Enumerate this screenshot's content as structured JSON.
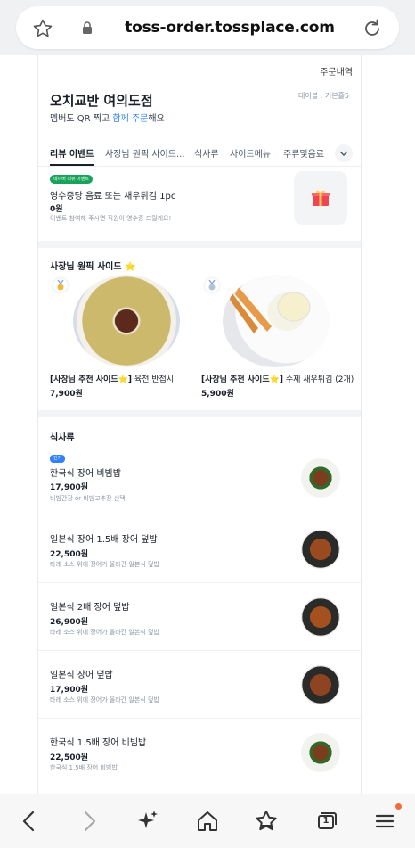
{
  "browser": {
    "url": "toss-order.tossplace.com"
  },
  "header": {
    "order_history": "주문내역",
    "store_name": "오치교반 여의도점",
    "table_label": "테이블 : 기본홀5",
    "sub_prefix": "멤버도 QR 찍고 ",
    "sub_highlight": "함께 주문",
    "sub_suffix": "해요"
  },
  "tabs": [
    {
      "label": "리뷰 이벤트",
      "active": true
    },
    {
      "label": "사장님 원픽 사이드...",
      "active": false
    },
    {
      "label": "식사류",
      "active": false
    },
    {
      "label": "사이드메뉴",
      "active": false
    },
    {
      "label": "주류및음료",
      "active": false
    }
  ],
  "event": {
    "badge": "네이버 리뷰 이벤트",
    "title": "영수증당 음료 또는 새우튀김 1pc",
    "price": "0원",
    "desc": "이벤트 참여해 주시면 직원이 영수증 드릴게요!"
  },
  "picks": {
    "title": "사장님 원픽 사이드 ⭐",
    "items": [
      {
        "prefix": "[사장님 추천 사이드⭐]",
        "name": " 육전 반접시",
        "price": "7,900원",
        "medal": "gold"
      },
      {
        "prefix": "[사장님 추천 사이드⭐]",
        "name": " 수제 새우튀김 (2개)",
        "price": "5,900원",
        "medal": "silver"
      }
    ]
  },
  "meals": {
    "title": "식사류",
    "items": [
      {
        "badge": "인기",
        "name": "한국식 장어 비빔밥",
        "price": "17,900원",
        "desc": "비빔간장 or 비빔고추장 선택"
      },
      {
        "name": "일본식 장어 1.5배 장어 덮밥",
        "price": "22,500원",
        "desc": "타레 소스 위에 장어가 올라간 일본식 덮밥"
      },
      {
        "name": "일본식 2배 장어 덮밥",
        "price": "26,900원",
        "desc": "타레 소스 위에 장어가 올라간 일본식 덮밥"
      },
      {
        "name": "일본식 장어 덮밥",
        "price": "17,900원",
        "desc": "타레 소스 위에 장어가 올라간 일본식 덮밥"
      },
      {
        "name": "한국식 1.5배 장어 비빔밥",
        "price": "22,500원",
        "desc": "한국식 1.5배 장어 비빔밥"
      }
    ]
  },
  "bottom_nav": {
    "icons": [
      "back-icon",
      "forward-icon",
      "sparkle-icon",
      "home-icon",
      "star-favorite-icon",
      "tabs-icon",
      "menu-icon"
    ],
    "tab_count": "1"
  }
}
